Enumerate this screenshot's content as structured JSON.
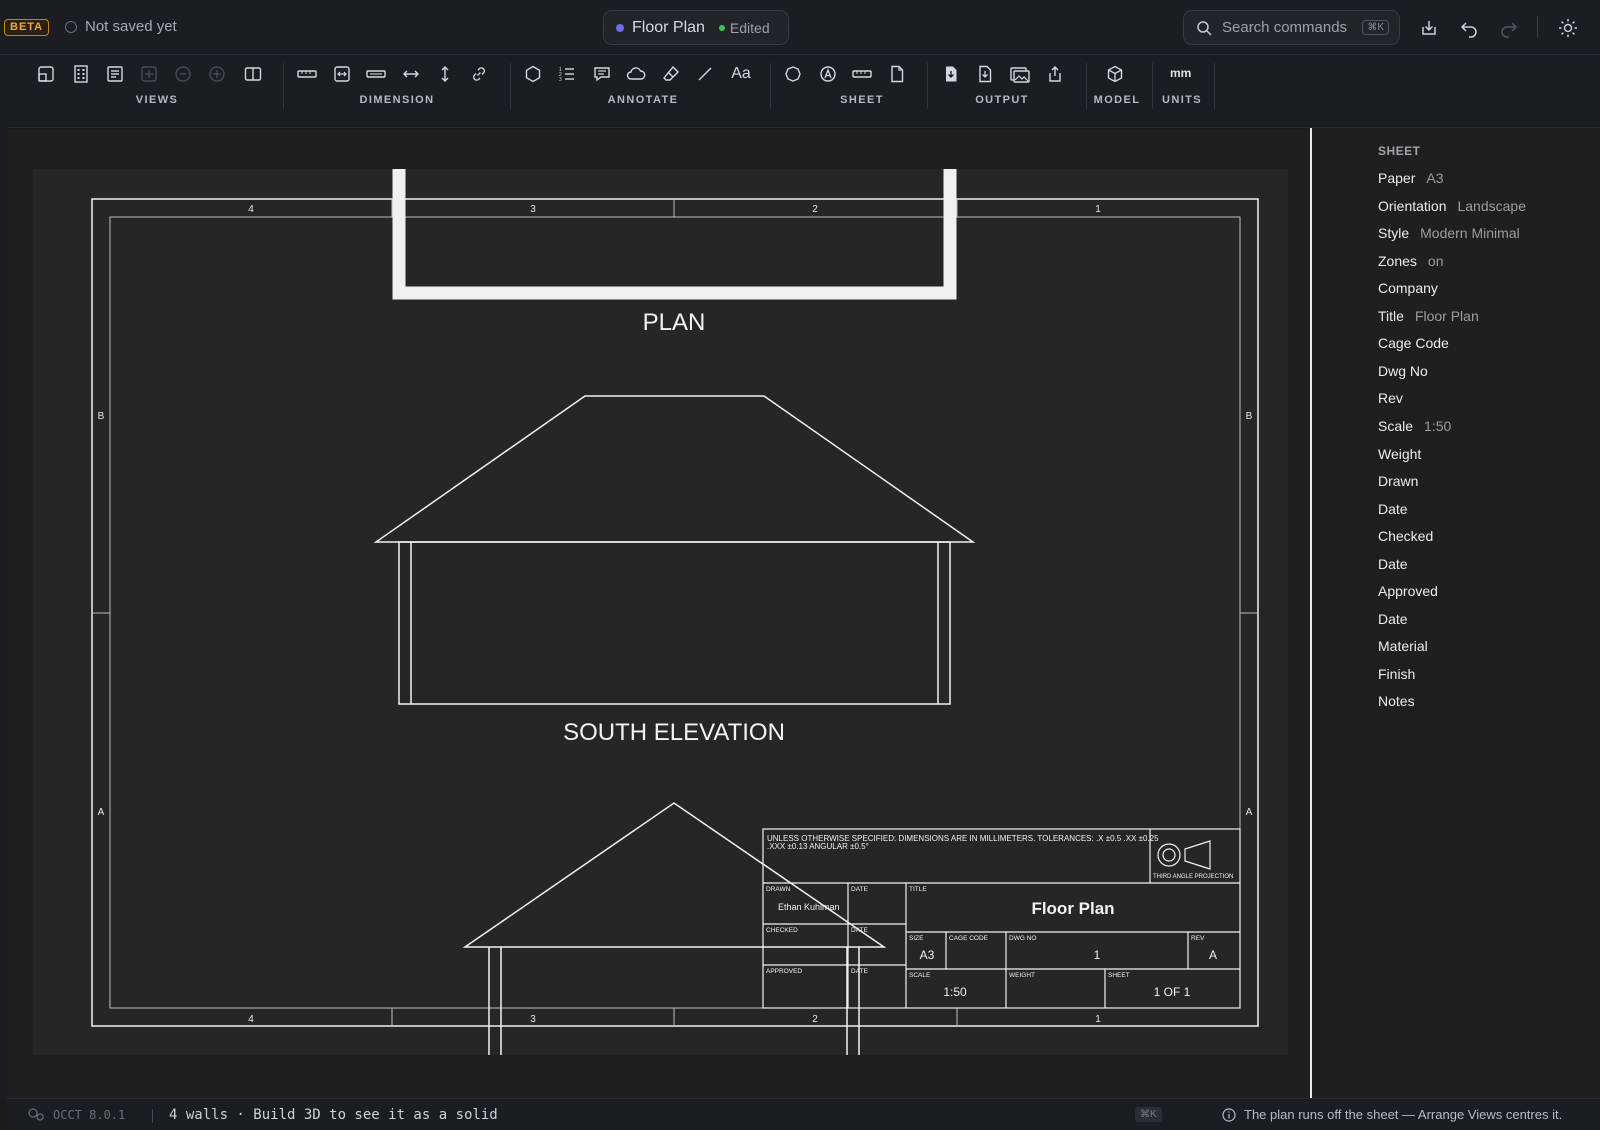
{
  "topbar": {
    "beta": "BETA",
    "save_status": "Not saved yet",
    "doc_title": "Floor Plan",
    "doc_status": "Edited",
    "search_placeholder": "Search commands",
    "search_shortcut": "⌘K"
  },
  "ribbon": {
    "groups": [
      "VIEWS",
      "DIMENSION",
      "ANNOTATE",
      "SHEET",
      "OUTPUT",
      "MODEL",
      "UNITS"
    ],
    "units_value": "mm"
  },
  "drawing": {
    "zones_top": [
      "4",
      "3",
      "2",
      "1"
    ],
    "zones_side": [
      "B",
      "A"
    ],
    "plan_label": "PLAN",
    "elevation_label": "SOUTH ELEVATION",
    "title_block": {
      "note": "UNLESS OTHERWISE SPECIFIED: DIMENSIONS ARE IN MILLIMETERS. TOLERANCES: .X ±0.5 .XX ±0.25",
      "note2": ".XXX ±0.13 ANGULAR ±0.5°",
      "projection": "THIRD ANGLE PROJECTION",
      "drawn_label": "DRAWN",
      "drawn_value": "Ethan Kuhlman",
      "date_label": "DATE",
      "checked_label": "CHECKED",
      "approved_label": "APPROVED",
      "title_label": "TITLE",
      "title_value": "Floor Plan",
      "size_label": "SIZE",
      "size_value": "A3",
      "cage_label": "CAGE CODE",
      "dwg_label": "DWG NO",
      "dwg_value": "1",
      "rev_label": "REV",
      "rev_value": "A",
      "scale_label": "SCALE",
      "scale_value": "1:50",
      "weight_label": "WEIGHT",
      "sheet_label": "SHEET",
      "sheet_value": "1 OF 1"
    }
  },
  "panel": {
    "heading": "SHEET",
    "props": [
      {
        "k": "Paper",
        "v": "A3"
      },
      {
        "k": "Orientation",
        "v": "Landscape"
      },
      {
        "k": "Style",
        "v": "Modern Minimal"
      },
      {
        "k": "Zones",
        "v": "on"
      },
      {
        "k": "Company",
        "v": ""
      },
      {
        "k": "Title",
        "v": "Floor Plan"
      },
      {
        "k": "Cage Code",
        "v": ""
      },
      {
        "k": "Dwg No",
        "v": ""
      },
      {
        "k": "Rev",
        "v": ""
      },
      {
        "k": "Scale",
        "v": "1:50"
      },
      {
        "k": "Weight",
        "v": ""
      },
      {
        "k": "Drawn",
        "v": ""
      },
      {
        "k": "Date",
        "v": ""
      },
      {
        "k": "Checked",
        "v": ""
      },
      {
        "k": "Date",
        "v": ""
      },
      {
        "k": "Approved",
        "v": ""
      },
      {
        "k": "Date",
        "v": ""
      },
      {
        "k": "Material",
        "v": ""
      },
      {
        "k": "Finish",
        "v": ""
      },
      {
        "k": "Notes",
        "v": ""
      }
    ]
  },
  "statusbar": {
    "version": "OCCT 8.0.1",
    "message": "4 walls · Build 3D to see it as a solid",
    "shortcut": "⌘K",
    "warning": "The plan runs off the sheet — Arrange Views centres it."
  }
}
